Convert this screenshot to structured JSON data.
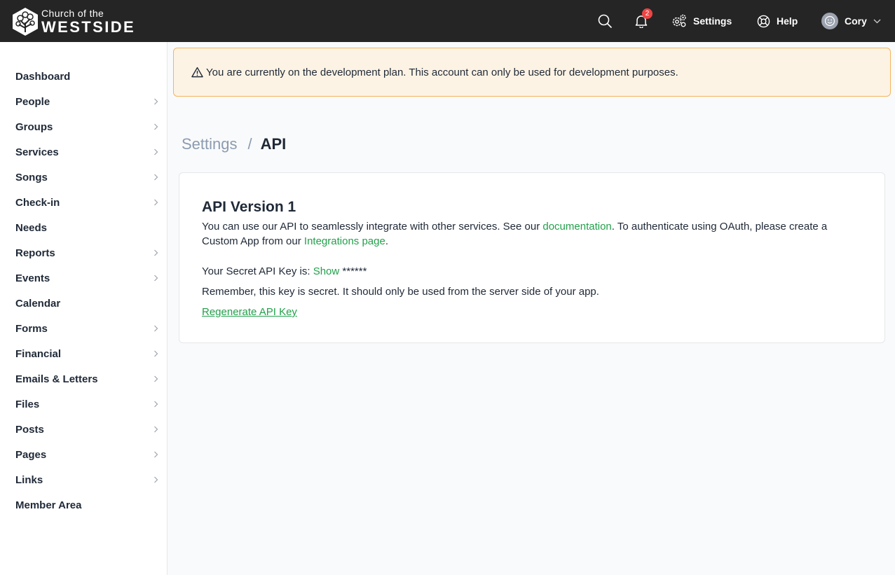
{
  "brand": {
    "line1": "Church of the",
    "line2": "WESTSIDE"
  },
  "topnav": {
    "notification_count": "2",
    "settings_label": "Settings",
    "help_label": "Help",
    "user_name": "Cory",
    "icons": [
      "search-icon",
      "bell-icon",
      "gears-icon",
      "lifebuoy-icon",
      "avatar-icon",
      "chevron-down-icon"
    ]
  },
  "sidebar": {
    "items": [
      {
        "label": "Dashboard",
        "has_children": false
      },
      {
        "label": "People",
        "has_children": true
      },
      {
        "label": "Groups",
        "has_children": true
      },
      {
        "label": "Services",
        "has_children": true
      },
      {
        "label": "Songs",
        "has_children": true
      },
      {
        "label": "Check-in",
        "has_children": true
      },
      {
        "label": "Needs",
        "has_children": false
      },
      {
        "label": "Reports",
        "has_children": true
      },
      {
        "label": "Events",
        "has_children": true
      },
      {
        "label": "Calendar",
        "has_children": false
      },
      {
        "label": "Forms",
        "has_children": true
      },
      {
        "label": "Financial",
        "has_children": true
      },
      {
        "label": "Emails & Letters",
        "has_children": true
      },
      {
        "label": "Files",
        "has_children": true
      },
      {
        "label": "Posts",
        "has_children": true
      },
      {
        "label": "Pages",
        "has_children": true
      },
      {
        "label": "Links",
        "has_children": true
      },
      {
        "label": "Member Area",
        "has_children": false
      }
    ]
  },
  "alert": {
    "text": "You are currently on the development plan. This account can only be used for development purposes."
  },
  "breadcrumb": {
    "parent": "Settings",
    "separator": "/",
    "current": "API"
  },
  "api_card": {
    "title": "API Version 1",
    "desc_part1": "You can use our API to seamlessly integrate with other services. See our ",
    "doc_link": "documentation",
    "desc_part2": ". To authenticate using OAuth, please create a Custom App from our ",
    "integrations_link": "Integrations page",
    "desc_part3": ".",
    "key_prefix": "Your Secret API Key is: ",
    "show_link": "Show",
    "key_masked": " ******",
    "secret_note": "Remember, this key is secret. It should only be used from the server side of your app.",
    "regenerate_link": "Regenerate API Key"
  },
  "colors": {
    "topbar": "#252525",
    "link_green": "#22a04b",
    "alert_bg": "#fdf3e4",
    "alert_border": "#f5b45a",
    "badge_red": "#ef4444"
  }
}
